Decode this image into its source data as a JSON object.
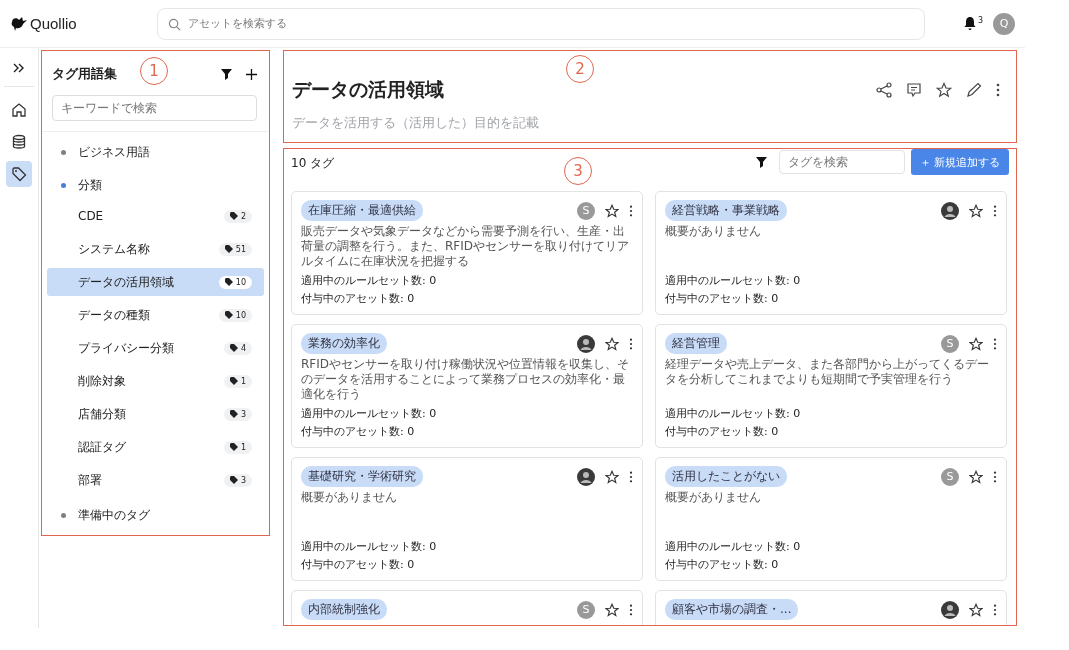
{
  "header": {
    "logo": "Quollio",
    "search": {
      "placeholder": "アセットを検索する"
    },
    "notifications": "3",
    "user_initial": "Q"
  },
  "rail": {
    "items": [
      {
        "kind": "home",
        "selected": false
      },
      {
        "kind": "database",
        "selected": false
      },
      {
        "kind": "tag",
        "selected": true
      }
    ]
  },
  "annotations": [
    "1",
    "2",
    "3"
  ],
  "sidebar": {
    "title": "タグ用語集",
    "search": {
      "placeholder": "キーワードで検索"
    },
    "tree": [
      {
        "label": "ビジネス用語",
        "color": "#808080"
      },
      {
        "label": "分類",
        "color": "#4a7fd9",
        "children": [
          {
            "label": "CDE",
            "count": "2",
            "selected": false
          },
          {
            "label": "システム名称",
            "count": "51",
            "selected": false
          },
          {
            "label": "データの活用領域",
            "count": "10",
            "selected": true
          },
          {
            "label": "データの種類",
            "count": "10",
            "selected": false
          },
          {
            "label": "プライバシー分類",
            "count": "4",
            "selected": false
          },
          {
            "label": "削除対象",
            "count": "1",
            "selected": false
          },
          {
            "label": "店舗分類",
            "count": "3",
            "selected": false
          },
          {
            "label": "認証タグ",
            "count": "1",
            "selected": false
          },
          {
            "label": "部署",
            "count": "3",
            "selected": false
          }
        ]
      },
      {
        "label": "準備中のタグ",
        "color": "#808080"
      }
    ]
  },
  "detail": {
    "title": "データの活用領域",
    "description": "データを活用する（活用した）目的を記載"
  },
  "tags": {
    "count": "10 タグ",
    "search": {
      "placeholder": "タグを検索"
    },
    "add_button": "＋ 新規追加する",
    "cards": [
      {
        "tag": "在庫圧縮・最適供給",
        "owner": {
          "kind": "initial",
          "initial": "S"
        },
        "summary": "販売データや気象データなどから需要予測を行い、生産・出荷量の調整を行う。また、RFIDやセンサーを取り付けてリアルタイムに在庫状況を把握する",
        "rulesets": "適用中のルールセット数: 0",
        "assets": "付与中のアセット数: 0"
      },
      {
        "tag": "経営戦略・事業戦略",
        "owner": {
          "kind": "photo"
        },
        "summary": "概要がありません",
        "rulesets": "適用中のルールセット数: 0",
        "assets": "付与中のアセット数: 0"
      },
      {
        "tag": "業務の効率化",
        "owner": {
          "kind": "photo"
        },
        "summary": "RFIDやセンサーを取り付け稼働状況や位置情報を収集し、そのデータを活用することによって業務プロセスの効率化・最適化を行う",
        "rulesets": "適用中のルールセット数: 0",
        "assets": "付与中のアセット数: 0"
      },
      {
        "tag": "経営管理",
        "owner": {
          "kind": "initial",
          "initial": "S"
        },
        "summary": "経理データや売上データ、また各部門から上がってくるデータを分析してこれまでよりも短期間で予実管理を行う",
        "rulesets": "適用中のルールセット数: 0",
        "assets": "付与中のアセット数: 0"
      },
      {
        "tag": "基礎研究・学術研究",
        "owner": {
          "kind": "photo"
        },
        "summary": "概要がありません",
        "rulesets": "適用中のルールセット数: 0",
        "assets": "付与中のアセット数: 0"
      },
      {
        "tag": "活用したことがない",
        "owner": {
          "kind": "initial",
          "initial": "S"
        },
        "summary": "概要がありません",
        "rulesets": "適用中のルールセット数: 0",
        "assets": "付与中のアセット数: 0"
      },
      {
        "tag": "内部統制強化",
        "owner": {
          "kind": "initial",
          "initial": "S"
        }
      },
      {
        "tag": "顧客や市場の調査・...",
        "owner": {
          "kind": "photo"
        }
      }
    ]
  }
}
